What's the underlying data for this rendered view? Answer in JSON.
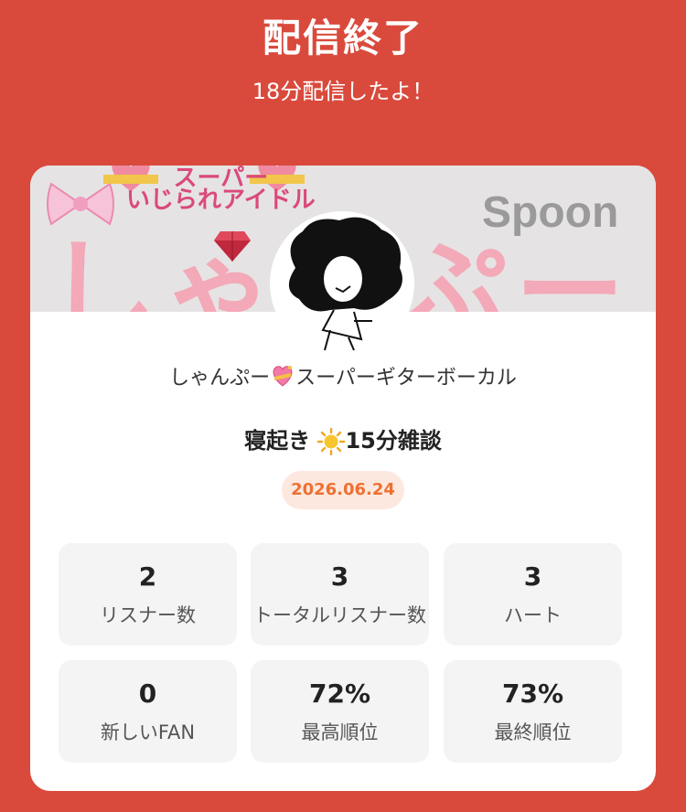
{
  "header": {
    "title": "配信終了",
    "subtitle": "18分配信したよ！"
  },
  "banner": {
    "idol_text_line1": "スーパー",
    "idol_text_line2": "いじられアイドル",
    "big_text": "しゃんぷー",
    "logo": "Spoon"
  },
  "profile": {
    "name_prefix": "しゃんぷー",
    "name_suffix": "スーパーギターボーカル",
    "heart_icon": "sparkling-heart-icon"
  },
  "live": {
    "title_prefix": "寝起き",
    "title_suffix": "15分雑談",
    "sun_icon": "sun-icon",
    "date": "2026.06.24"
  },
  "stats": [
    {
      "value": "2",
      "label": "リスナー数"
    },
    {
      "value": "3",
      "label": "トータルリスナー数"
    },
    {
      "value": "3",
      "label": "ハート"
    },
    {
      "value": "0",
      "label": "新しいFAN"
    },
    {
      "value": "72%",
      "label": "最高順位"
    },
    {
      "value": "73%",
      "label": "最終順位"
    }
  ],
  "colors": {
    "background": "#d94a3c",
    "date_text": "#ef6f32",
    "date_bg": "#fde8df"
  }
}
